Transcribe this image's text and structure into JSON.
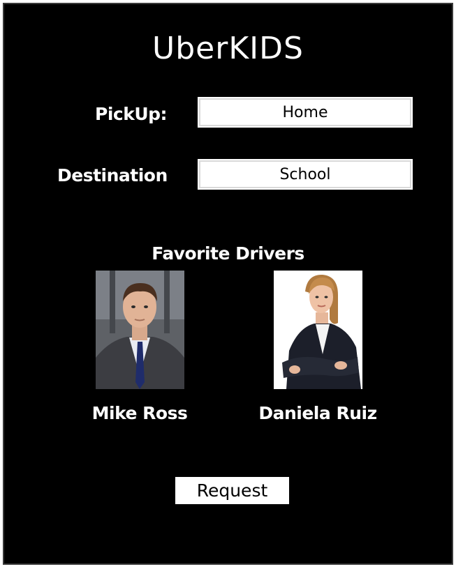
{
  "app": {
    "title": "UberKIDS"
  },
  "form": {
    "pickup": {
      "label": "PickUp:",
      "value": "Home"
    },
    "destination": {
      "label": "Destination",
      "value": "School"
    }
  },
  "favorites": {
    "title": "Favorite Drivers",
    "drivers": [
      {
        "name": "Mike Ross"
      },
      {
        "name": "Daniela Ruiz"
      }
    ]
  },
  "actions": {
    "request_label": "Request"
  }
}
